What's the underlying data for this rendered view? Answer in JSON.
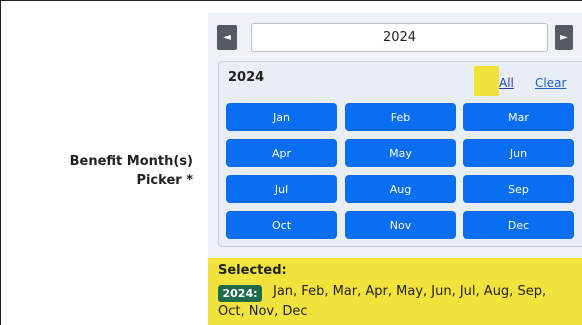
{
  "field": {
    "label_line1": "Benefit Month(s)",
    "label_line2": "Picker *"
  },
  "navigator": {
    "prev_icon": "triangle-left-icon",
    "prev_glyph": "◄",
    "next_icon": "triangle-right-icon",
    "next_glyph": "►",
    "year_value": "2024"
  },
  "panel": {
    "year_heading": "2024",
    "all_label": "All",
    "clear_label": "Clear",
    "months": [
      "Jan",
      "Feb",
      "Mar",
      "Apr",
      "May",
      "Jun",
      "Jul",
      "Aug",
      "Sep",
      "Oct",
      "Nov",
      "Dec"
    ]
  },
  "selection": {
    "title": "Selected:",
    "year_badge": "2024:",
    "months_line1": "Jan, Feb, Mar, Apr, May, Jun, Jul, Aug, Sep,",
    "months_line2": "Oct, Nov, Dec"
  },
  "colors": {
    "month_button": "#0a6ef0",
    "highlight": "#f2e33c",
    "badge": "#1d6b4a"
  }
}
